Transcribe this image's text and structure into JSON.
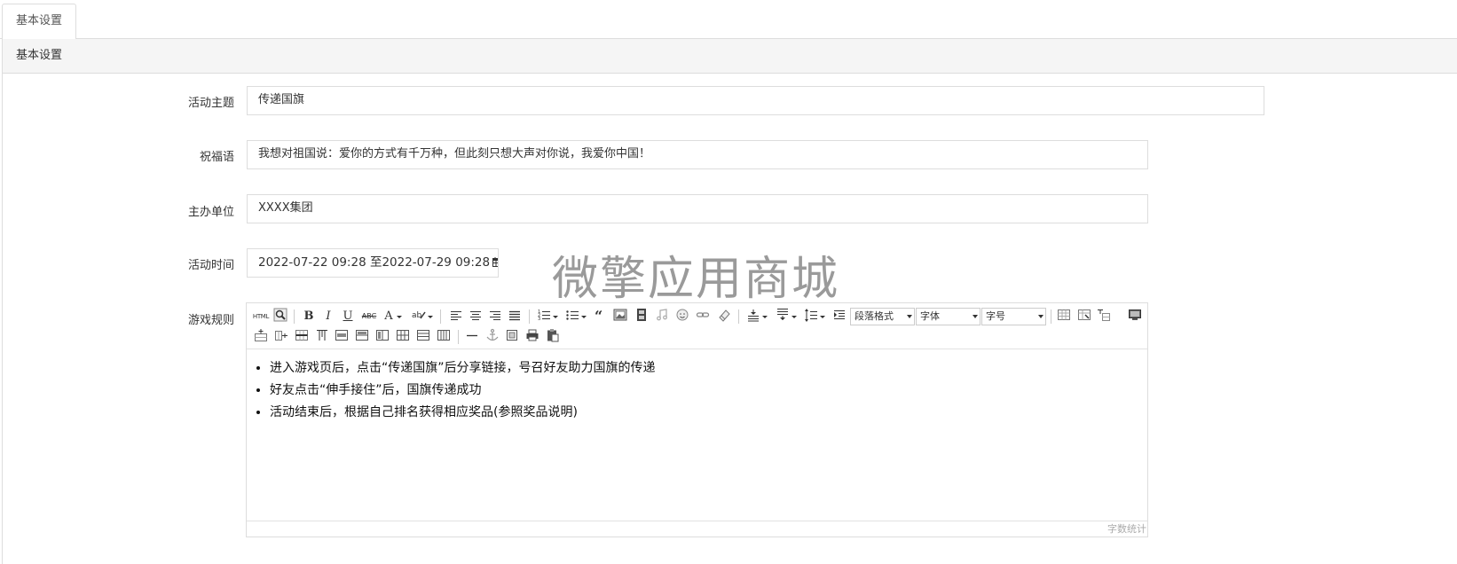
{
  "tabs": [
    {
      "label": "基本设置"
    }
  ],
  "panel": {
    "title": "基本设置"
  },
  "form": {
    "theme": {
      "label": "活动主题",
      "value": "传递国旗"
    },
    "blessing": {
      "label": "祝福语",
      "value": "我想对祖国说：爱你的方式有千万种，但此刻只想大声对你说，我爱你中国！"
    },
    "organizer": {
      "label": "主办单位",
      "value": "XXXX集团"
    },
    "time": {
      "label": "活动时间",
      "value": "2022-07-22 09:28 至2022-07-29 09:28"
    },
    "rules": {
      "label": "游戏规则"
    }
  },
  "watermark": "微擎应用商城",
  "editor": {
    "toolbar": {
      "html_label": "HTML",
      "bold": "B",
      "italic": "I",
      "underline": "U",
      "strike": "ABC",
      "fontcolor": "A",
      "paragraph_select": "段落格式",
      "font_select": "字体",
      "size_select": "字号",
      "icons": [
        "html-icon",
        "preview-icon",
        "bold-icon",
        "italic-icon",
        "underline-icon",
        "strikethrough-icon",
        "font-color-icon",
        "highlight-icon",
        "align-left-icon",
        "align-center-icon",
        "align-right-icon",
        "align-justify-icon",
        "ordered-list-icon",
        "unordered-list-icon",
        "blockquote-icon",
        "image-icon",
        "video-icon",
        "music-icon",
        "emotion-icon",
        "link-icon",
        "eraser-icon",
        "row-spacing-top-icon",
        "row-spacing-bottom-icon",
        "line-height-icon",
        "indent-icon",
        "insert-table-icon",
        "table-props-icon",
        "cell-props-icon",
        "fullscreen-icon",
        "insert-row-icon",
        "insert-col-icon",
        "delete-row-icon",
        "delete-col-icon",
        "merge-cells-icon",
        "split-cells-icon",
        "horizontal-rule-icon",
        "anchor-icon",
        "pagebreak-icon",
        "print-icon",
        "paste-icon"
      ]
    },
    "content": [
      "进入游戏页后，点击“传递国旗”后分享链接，号召好友助力国旗的传递",
      "好友点击“伸手接住”后，国旗传递成功",
      "活动结束后，根据自己排名获得相应奖品(参照奖品说明)"
    ],
    "wordcount": "字数统计"
  }
}
